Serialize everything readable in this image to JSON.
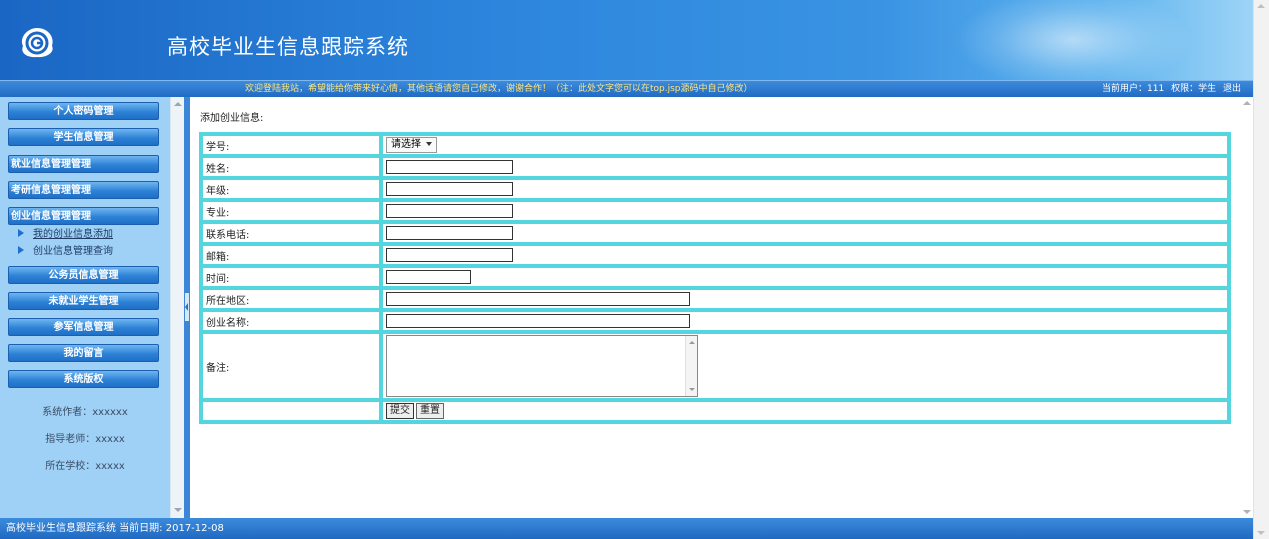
{
  "header": {
    "title": "高校毕业生信息跟踪系统",
    "welcome": "欢迎登陆我站，希望能给你带来好心情，其他话语请您自己修改，谢谢合作！（注：此处文字您可以在top.jsp源码中自己修改）",
    "user_label": "当前用户：111",
    "role_label": "权限：学生",
    "logout": "退出"
  },
  "sidebar": {
    "menus": [
      {
        "label": "个人密码管理"
      },
      {
        "label": "学生信息管理"
      },
      {
        "label": "就业信息管理管理"
      },
      {
        "label": "考研信息管理管理"
      },
      {
        "label": "创业信息管理管理"
      },
      {
        "label": "公务员信息管理"
      },
      {
        "label": "未就业学生管理"
      },
      {
        "label": "参军信息管理"
      },
      {
        "label": "我的留言"
      },
      {
        "label": "系统版权"
      }
    ],
    "sub_items": [
      "我的创业信息添加",
      "创业信息管理查询"
    ],
    "info": [
      "系统作者：xxxxxx",
      "指导老师：xxxxx",
      "所在学校：xxxxx"
    ]
  },
  "form": {
    "title": "添加创业信息:",
    "fields": [
      {
        "label": "学号:",
        "select_value": "请选择"
      },
      {
        "label": "姓名:"
      },
      {
        "label": "年级:"
      },
      {
        "label": "专业:"
      },
      {
        "label": "联系电话:"
      },
      {
        "label": "邮箱:"
      },
      {
        "label": "时间:"
      },
      {
        "label": "所在地区:"
      },
      {
        "label": "创业名称:"
      },
      {
        "label": "备注:"
      }
    ],
    "submit": "提交",
    "reset": "重置"
  },
  "footer": {
    "text": "高校毕业生信息跟踪系统 当前日期: 2017-12-08"
  }
}
